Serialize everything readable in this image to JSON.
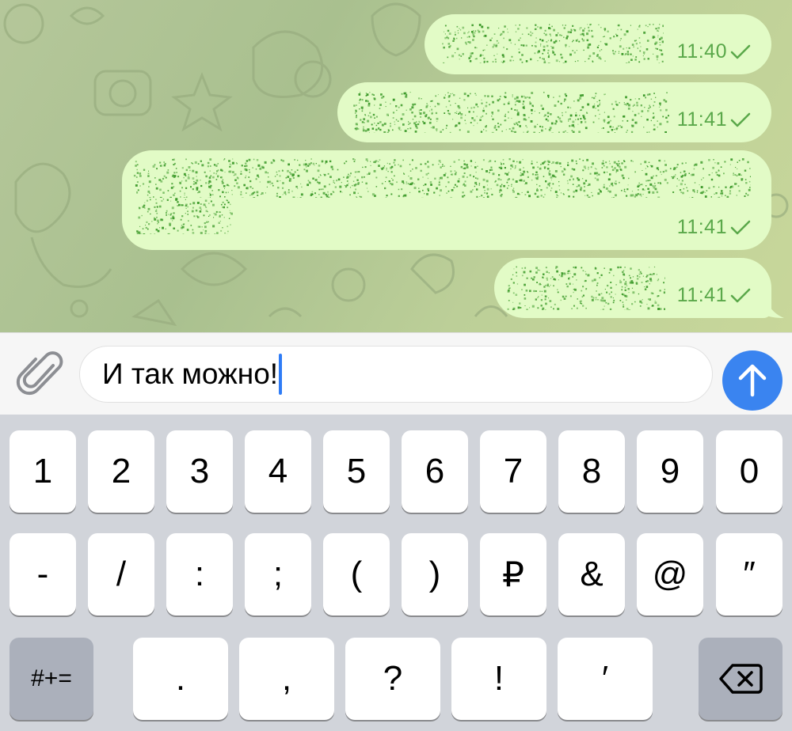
{
  "chat": {
    "messages": [
      {
        "time": "11:40",
        "text_hidden": true
      },
      {
        "time": "11:41",
        "text_hidden": true
      },
      {
        "time": "11:41",
        "text_hidden": true
      },
      {
        "time": "11:41",
        "text_hidden": true
      }
    ],
    "colors": {
      "bubble": "#e2fbc6",
      "time": "#5aa84a",
      "noise": "#3c9a2a"
    }
  },
  "composer": {
    "value": "И так можно!",
    "attach_icon": "paperclip-icon",
    "send_icon": "arrow-up-icon",
    "send_color": "#3a84f0"
  },
  "keyboard": {
    "row1": [
      "1",
      "2",
      "3",
      "4",
      "5",
      "6",
      "7",
      "8",
      "9",
      "0"
    ],
    "row2": [
      "-",
      "/",
      ":",
      ";",
      "(",
      ")",
      "₽",
      "&",
      "@",
      "″"
    ],
    "row3_left": "#+=",
    "row3": [
      ".",
      ",",
      "?",
      "!",
      "′"
    ],
    "backspace_icon": "backspace-icon"
  }
}
